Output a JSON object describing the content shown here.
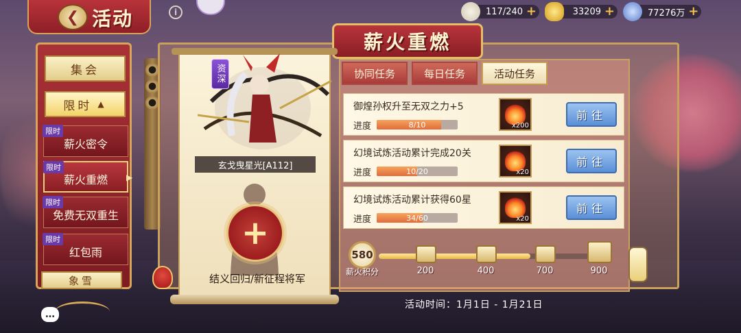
{
  "header": {
    "title": "活动",
    "info_symbol": "i"
  },
  "currencies": [
    {
      "icon": "bun-icon",
      "value": "117/240"
    },
    {
      "icon": "gold-ingot-icon",
      "value": "33209"
    },
    {
      "icon": "coin-icon",
      "value": "77276万"
    }
  ],
  "sidebar": {
    "gather": "集会",
    "limited": "限时",
    "items": [
      {
        "tag": "限时",
        "label": "薪火密令"
      },
      {
        "tag": "限时",
        "label": "薪火重燃"
      },
      {
        "tag": "限时",
        "label": "免费无双重生"
      },
      {
        "tag": "限时",
        "label": "红包雨"
      }
    ],
    "partial": "象雪"
  },
  "panel": {
    "title": "薪火重燃",
    "badge": "资深",
    "character_name": "玄戈曳星光[A112]",
    "recruit_label": "结义回归/新征程将军"
  },
  "tabs": [
    "协同任务",
    "每日任务",
    "活动任务"
  ],
  "active_tab": 2,
  "tasks": [
    {
      "title": "御煌孙权升至无双之力+5",
      "progress_label": "进度",
      "progress_text": "8/10",
      "progress": 0.8,
      "reward_count": "x200",
      "button": "前往"
    },
    {
      "title": "幻境试炼活动累计完成20关",
      "progress_label": "进度",
      "progress_text": "10/20",
      "progress": 0.5,
      "reward_count": "x20",
      "button": "前往"
    },
    {
      "title": "幻境试炼活动累计获得60星",
      "progress_label": "进度",
      "progress_text": "34/60",
      "progress": 0.5667,
      "reward_count": "x20",
      "button": "前往"
    }
  ],
  "points": {
    "value": "580",
    "label": "薪火积分",
    "progress": 0.69,
    "milestones": [
      "200",
      "400",
      "700",
      "900"
    ]
  },
  "activity_time": "活动时间：1月1日 - 1月21日",
  "colors": {
    "accent_red": "#a93237",
    "gold": "#d6a65a",
    "button_blue": "#5a8fd8",
    "progress_orange": "#e06d3c"
  }
}
